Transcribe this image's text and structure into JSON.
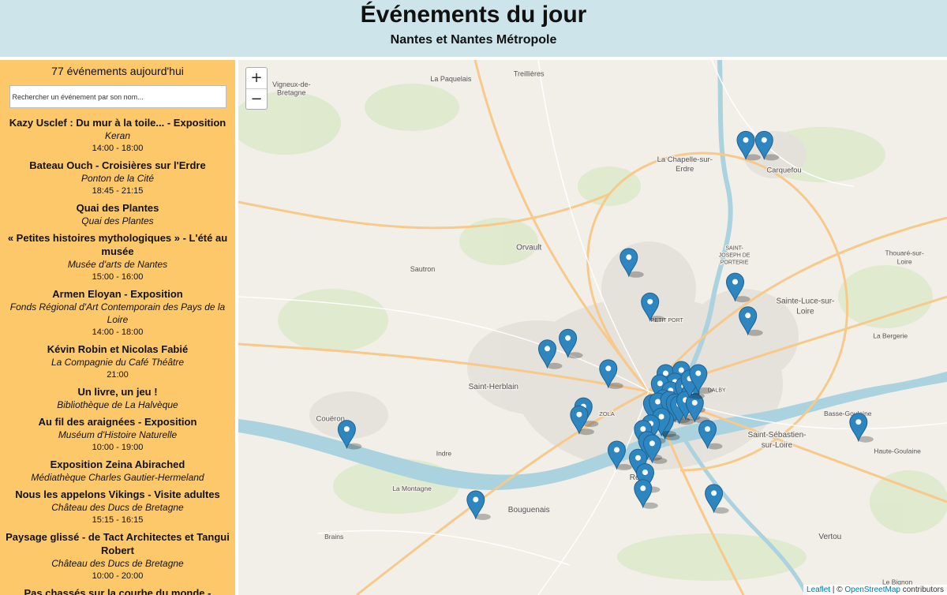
{
  "header": {
    "title": "Événements du jour",
    "subtitle": "Nantes et Nantes Métropole"
  },
  "sidebar": {
    "count_text": "77 événements aujourd'hui",
    "search_placeholder": "Rechercher un événement par son nom...",
    "events": [
      {
        "title": "Kazy Usclef : Du mur à la toile... - Exposition",
        "place": "Keran",
        "time": "14:00 - 18:00"
      },
      {
        "title": "Bateau Ouch - Croisières sur l'Erdre",
        "place": "Ponton de la Cité",
        "time": "18:45 - 21:15"
      },
      {
        "title": "Quai des Plantes",
        "place": "Quai des Plantes",
        "time": ""
      },
      {
        "title": "« Petites histoires mythologiques » - L'été au musée",
        "place": "Musée d'arts de Nantes",
        "time": "15:00 - 16:00"
      },
      {
        "title": "Armen Eloyan - Exposition",
        "place": "Fonds Régional d'Art Contemporain des Pays de la Loire",
        "time": "14:00 - 18:00"
      },
      {
        "title": "Kévin Robin et Nicolas Fabié",
        "place": "La Compagnie du Café Théâtre",
        "time": "21:00"
      },
      {
        "title": "Un livre, un jeu !",
        "place": "Bibliothèque de La Halvèque",
        "time": ""
      },
      {
        "title": "Au fil des araignées - Exposition",
        "place": "Muséum d'Histoire Naturelle",
        "time": "10:00 - 19:00"
      },
      {
        "title": "Exposition Zeina Abirached",
        "place": "Médiathèque Charles Gautier-Hermeland",
        "time": ""
      },
      {
        "title": "Nous les appelons Vikings - Visite adultes",
        "place": "Château des Ducs de Bretagne",
        "time": "15:15 - 16:15"
      },
      {
        "title": "Paysage glissé - de Tact Architectes et Tangui Robert",
        "place": "Château des Ducs de Bretagne",
        "time": "10:00 - 20:00"
      },
      {
        "title": "Pas chassés sur la courbe du monde - Festival Aux heures d'été",
        "place": "",
        "time": ""
      }
    ]
  },
  "map": {
    "zoom_in": "+",
    "zoom_out": "−",
    "attribution": {
      "leaflet": "Leaflet",
      "sep": " | © ",
      "osm": "OpenStreetMap",
      "suffix": " contributors"
    },
    "marker_color": "#2e86c1",
    "place_labels": [
      {
        "name": "La Paquelais",
        "x": 30,
        "y": 4,
        "size": 9,
        "bold": false
      },
      {
        "name": "Treillières",
        "x": 41,
        "y": 3,
        "size": 9,
        "bold": false
      },
      {
        "name": "Vigneux-de-",
        "x": 7.5,
        "y": 5,
        "size": 9,
        "bold": false
      },
      {
        "name": "Bretagne",
        "x": 7.5,
        "y": 6.6,
        "size": 9,
        "bold": false
      },
      {
        "name": "La Chapelle-sur-",
        "x": 63,
        "y": 19,
        "size": 9.5,
        "bold": false
      },
      {
        "name": "Erdre",
        "x": 63,
        "y": 20.8,
        "size": 9.5,
        "bold": false
      },
      {
        "name": "Carquefou",
        "x": 77,
        "y": 21,
        "size": 9.5,
        "bold": false
      },
      {
        "name": "Orvault",
        "x": 41,
        "y": 35.5,
        "size": 10,
        "bold": false
      },
      {
        "name": "Sautron",
        "x": 26,
        "y": 39.5,
        "size": 9,
        "bold": false
      },
      {
        "name": "SAINT-",
        "x": 70,
        "y": 35.5,
        "size": 7,
        "bold": false
      },
      {
        "name": "JOSEPH DE",
        "x": 70,
        "y": 36.8,
        "size": 7,
        "bold": false
      },
      {
        "name": "PORTERIE",
        "x": 70,
        "y": 38.1,
        "size": 7,
        "bold": false
      },
      {
        "name": "Thouaré-sur-",
        "x": 94,
        "y": 36.5,
        "size": 8.5,
        "bold": false
      },
      {
        "name": "Loire",
        "x": 94,
        "y": 38.1,
        "size": 8.5,
        "bold": false
      },
      {
        "name": "Sainte-Luce-sur-",
        "x": 80,
        "y": 45.5,
        "size": 10,
        "bold": false
      },
      {
        "name": "Loire",
        "x": 80,
        "y": 47.4,
        "size": 10,
        "bold": false
      },
      {
        "name": "PETIT PORT",
        "x": 60.5,
        "y": 49,
        "size": 7,
        "bold": false
      },
      {
        "name": "La Bergerie",
        "x": 92,
        "y": 52,
        "size": 8.5,
        "bold": false
      },
      {
        "name": "Saint-Herblain",
        "x": 36,
        "y": 61.5,
        "size": 10,
        "bold": false
      },
      {
        "name": "DALBY",
        "x": 67.5,
        "y": 62,
        "size": 7,
        "bold": false
      },
      {
        "name": "ZOLA",
        "x": 52,
        "y": 66.5,
        "size": 7.5,
        "bold": false
      },
      {
        "name": "Basse-Goulaine",
        "x": 86,
        "y": 66.5,
        "size": 8.5,
        "bold": false
      },
      {
        "name": "Couëron",
        "x": 13,
        "y": 67.5,
        "size": 9.5,
        "bold": false
      },
      {
        "name": "Saint-Sébastien-",
        "x": 76,
        "y": 70.5,
        "size": 10,
        "bold": false
      },
      {
        "name": "sur-Loire",
        "x": 76,
        "y": 72.4,
        "size": 10,
        "bold": false
      },
      {
        "name": "Indre",
        "x": 29,
        "y": 74,
        "size": 8.5,
        "bold": false
      },
      {
        "name": "Haute-Goulaine",
        "x": 93,
        "y": 73.5,
        "size": 8.5,
        "bold": false
      },
      {
        "name": "Rezé",
        "x": 56.5,
        "y": 78.5,
        "size": 10,
        "bold": false
      },
      {
        "name": "La Montagne",
        "x": 24.5,
        "y": 80.5,
        "size": 8.5,
        "bold": false
      },
      {
        "name": "Bouguenais",
        "x": 41,
        "y": 84.5,
        "size": 10,
        "bold": false
      },
      {
        "name": "Brains",
        "x": 13.5,
        "y": 89.5,
        "size": 8.5,
        "bold": false
      },
      {
        "name": "Vertou",
        "x": 83.5,
        "y": 89.5,
        "size": 10,
        "bold": false
      },
      {
        "name": "Le Bignon",
        "x": 93,
        "y": 98,
        "size": 8.5,
        "bold": false
      }
    ],
    "markers": [
      {
        "x": 71.6,
        "y": 18.5
      },
      {
        "x": 74.2,
        "y": 18.5
      },
      {
        "x": 55.1,
        "y": 40.4
      },
      {
        "x": 70.1,
        "y": 45
      },
      {
        "x": 58.1,
        "y": 48.7
      },
      {
        "x": 71.9,
        "y": 51.3
      },
      {
        "x": 46.5,
        "y": 55.5
      },
      {
        "x": 43.6,
        "y": 57.5
      },
      {
        "x": 52.2,
        "y": 61.2
      },
      {
        "x": 60.3,
        "y": 62.1
      },
      {
        "x": 62.5,
        "y": 61.5
      },
      {
        "x": 61.6,
        "y": 63.7
      },
      {
        "x": 59.5,
        "y": 64
      },
      {
        "x": 61,
        "y": 65.3
      },
      {
        "x": 60,
        "y": 66.8
      },
      {
        "x": 62.9,
        "y": 64.5
      },
      {
        "x": 63.8,
        "y": 65.7
      },
      {
        "x": 58.4,
        "y": 67.7
      },
      {
        "x": 59.2,
        "y": 67.4
      },
      {
        "x": 60.8,
        "y": 67.1
      },
      {
        "x": 61.6,
        "y": 67.6
      },
      {
        "x": 62.2,
        "y": 67.9
      },
      {
        "x": 63.1,
        "y": 67.1
      },
      {
        "x": 64.4,
        "y": 67.6
      },
      {
        "x": 63.7,
        "y": 63.1
      },
      {
        "x": 64.9,
        "y": 62.1
      },
      {
        "x": 60.2,
        "y": 70.8
      },
      {
        "x": 59.7,
        "y": 70.2
      },
      {
        "x": 58.2,
        "y": 71.5
      },
      {
        "x": 57.1,
        "y": 72.5
      },
      {
        "x": 66.2,
        "y": 72.5
      },
      {
        "x": 57.7,
        "y": 74.6
      },
      {
        "x": 58.4,
        "y": 75.2
      },
      {
        "x": 53.4,
        "y": 76.4
      },
      {
        "x": 56.4,
        "y": 77.9
      },
      {
        "x": 48.7,
        "y": 68.3
      },
      {
        "x": 48.1,
        "y": 69.8
      },
      {
        "x": 87.5,
        "y": 71.2
      },
      {
        "x": 15.3,
        "y": 72.5
      },
      {
        "x": 57.4,
        "y": 80.6
      },
      {
        "x": 57.1,
        "y": 83.6
      },
      {
        "x": 67.1,
        "y": 84.5
      },
      {
        "x": 33.5,
        "y": 85.7
      }
    ]
  }
}
